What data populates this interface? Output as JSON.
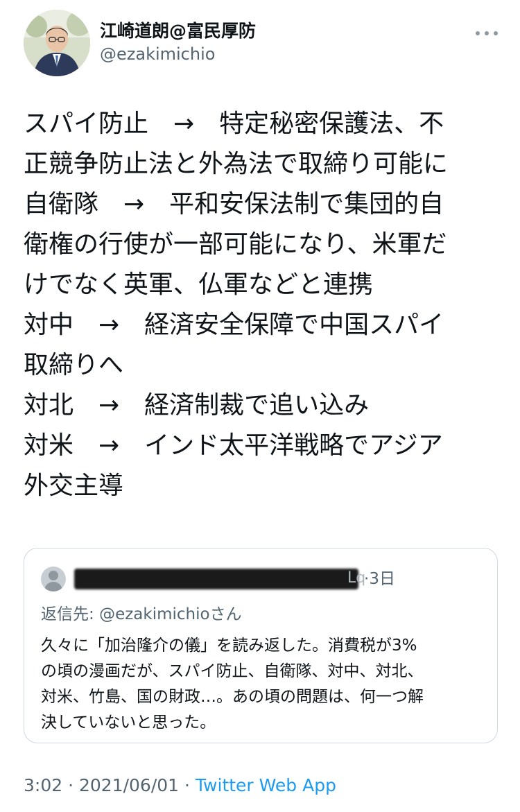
{
  "author": {
    "display_name": "江崎道朗@富民厚防",
    "handle": "@ezakimichio",
    "avatar_icon": "profile-photo"
  },
  "more_icon": "more-horizontal-icon",
  "tweet": {
    "lines": [
      "スパイ防止　→　特定秘密保護法、不",
      "正競争防止法と外為法で取締り可能に",
      "自衛隊　→　平和安保法制で集団的自",
      "衛権の行使が一部可能になり、米軍だ",
      "けでなく英軍、仏軍などと連携",
      "対中　→　経済安全保障で中国スパイ",
      "取締りへ",
      "対北　→　経済制裁で追い込み",
      "対米　→　インド太平洋戦略でアジア",
      "外交主導"
    ]
  },
  "quote": {
    "handle_tail": "Lq",
    "separator": "·",
    "time": "3日",
    "reply_to_prefix": "返信先: ",
    "reply_to_mention": "@ezakimichio",
    "reply_to_suffix": "さん",
    "lines": [
      "久々に「加治隆介の儀」を読み返した。消費税が3%",
      "の頃の漫画だが、スパイ防止、自衛隊、対中、対北、",
      "対米、竹島、国の財政…。あの頃の問題は、何一つ解",
      "決していないと思った。"
    ]
  },
  "meta": {
    "time": "3:02",
    "separator": " · ",
    "date": "2021/06/01",
    "source": "Twitter Web App"
  },
  "colors": {
    "text": "#0f1419",
    "secondary": "#536471",
    "link": "#1d9bf0",
    "border": "#cfd9de"
  }
}
